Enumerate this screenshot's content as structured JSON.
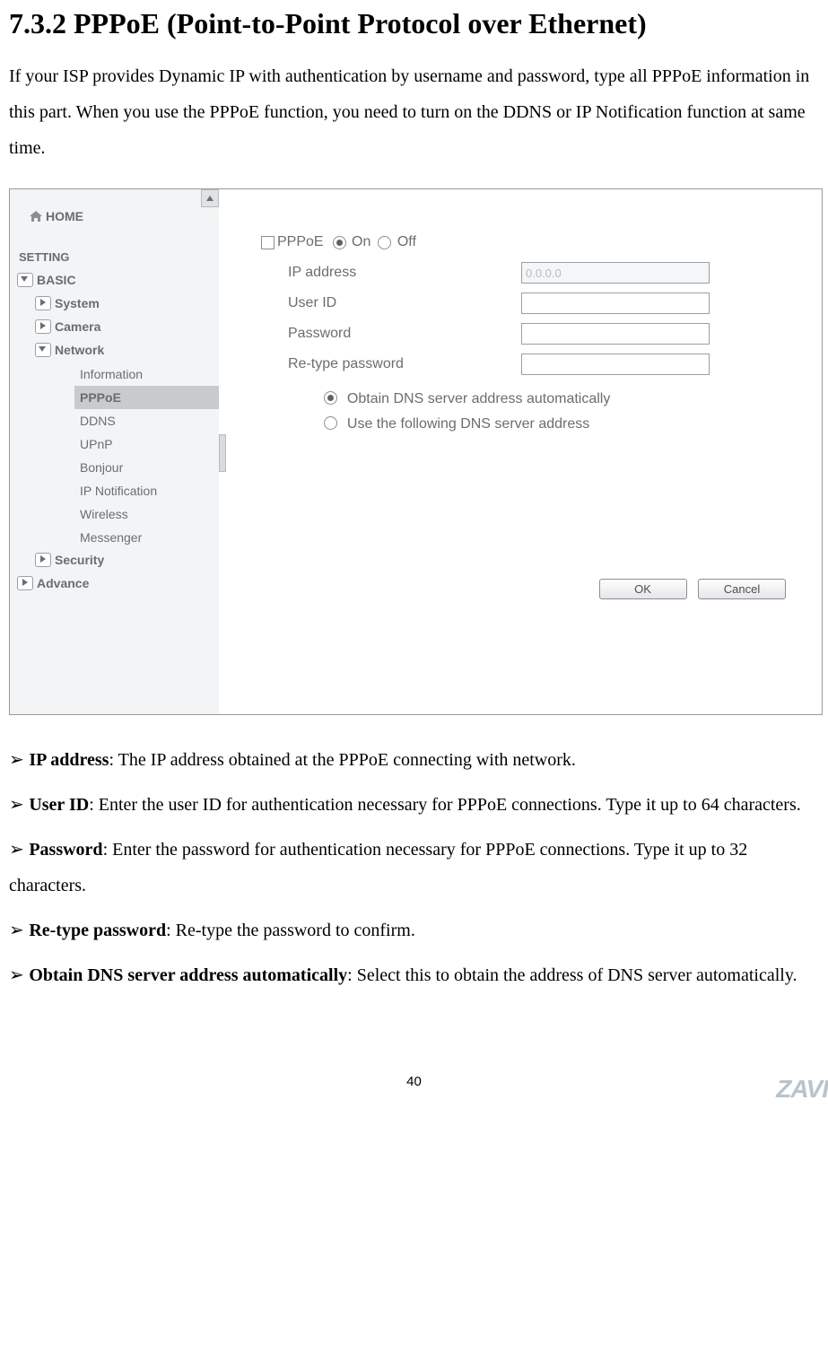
{
  "section_title": "7.3.2 PPPoE (Point-to-Point Protocol over Ethernet)",
  "intro": "If your ISP provides Dynamic IP with authentication by username and password, type all PPPoE information in this part. When you use the PPPoE function, you need to turn on the DDNS or IP Notification function at same time.",
  "screenshot": {
    "home": "HOME",
    "setting": "SETTING",
    "nodes": {
      "basic": "BASIC",
      "system": "System",
      "camera": "Camera",
      "network": "Network",
      "security": "Security",
      "advance": "Advance"
    },
    "network_items": [
      "Information",
      "PPPoE",
      "DDNS",
      "UPnP",
      "Bonjour",
      "IP Notification",
      "Wireless",
      "Messenger"
    ],
    "selected_network_item": "PPPoE",
    "form": {
      "pppoe_label": "PPPoE",
      "on": "On",
      "off": "Off",
      "ip_label": "IP address",
      "ip_value": "0.0.0.0",
      "userid_label": "User ID",
      "password_label": "Password",
      "retype_label": "Re-type password",
      "dns_auto": "Obtain DNS server address automatically",
      "dns_manual": "Use the following DNS server address",
      "ok": "OK",
      "cancel": "Cancel"
    }
  },
  "descriptions": [
    {
      "term": "IP address",
      "text": ": The IP address obtained at the PPPoE connecting with network."
    },
    {
      "term": "User ID",
      "text": ": Enter the user ID for authentication necessary for PPPoE connections. Type it up to 64 characters."
    },
    {
      "term": "Password",
      "text": ": Enter the password for authentication necessary for PPPoE connections. Type it up to 32 characters."
    },
    {
      "term": "Re-type password",
      "text": ": Re-type the password to confirm."
    },
    {
      "term": "Obtain DNS server address automatically",
      "text": ": Select this to obtain the address of DNS server automatically."
    }
  ],
  "page_number": "40",
  "brand_fragment": "ZAVI"
}
